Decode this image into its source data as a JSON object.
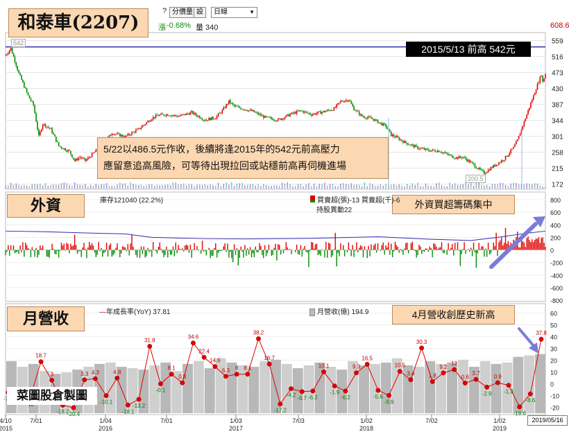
{
  "title": "和泰車(2207)",
  "toolbar": {
    "help": "?",
    "adjust_label": "分價量",
    "settings_label": "設",
    "period_select": "日線",
    "change_prefix": "漲",
    "change_value": "-0.68%",
    "volume_label": "量 340"
  },
  "panels": {
    "foreign_label": "外資",
    "revenue_label": "月營收",
    "foreign_info": "庫存121040 (22.2%)",
    "foreign_legend_1": "買賣超(張)-13 買賣超(千)-6",
    "foreign_legend_2": "持股異動22",
    "revenue_legend_1": "年成長率(YoY) 37.81",
    "revenue_legend_2": "月營收(億) 194.9"
  },
  "annotations": {
    "high_note": "2015/5/13 前高 542元",
    "price_note_1": "5/22以486.5元作收，後續將逢2015年的542元前高壓力",
    "price_note_2": "應留意追高風險，可等待出現拉回或站穩前高再伺機進場",
    "foreign_note": "外資買超籌碼集中",
    "revenue_note": "4月營收創歷史新高",
    "watermark": "菜圖股倉製圖",
    "date_badge": "2019/05/16",
    "high_tag": "542",
    "low_tag": "200.5",
    "right_top": "608.6"
  },
  "colors": {
    "up": "#e00000",
    "down": "#008a00",
    "line": "#2b2bb0",
    "bar": "#b8b8b8",
    "hl": "#7b7bd8"
  },
  "chart_data": [
    {
      "type": "line",
      "title": "和泰車(2207)",
      "y_ticks": [
        "559",
        "516",
        "473",
        "430",
        "387",
        "344",
        "301",
        "258",
        "215",
        "172"
      ],
      "ylim": [
        160,
        575
      ],
      "reference_line": 542,
      "x_ticks": [
        "4/10\n2015",
        "7/01",
        "1/04\n2016",
        "7/01",
        "1/03\n2017",
        "7/03",
        "1/02\n2018",
        "7/02",
        "1/02\n2019"
      ],
      "anchors": [
        [
          0,
          520
        ],
        [
          4,
          538
        ],
        [
          10,
          470
        ],
        [
          17,
          410
        ],
        [
          21,
          385
        ],
        [
          25,
          300
        ],
        [
          28,
          335
        ],
        [
          34,
          320
        ],
        [
          40,
          275
        ],
        [
          48,
          260
        ],
        [
          52,
          235
        ],
        [
          56,
          245
        ],
        [
          60,
          235
        ],
        [
          66,
          255
        ],
        [
          72,
          275
        ],
        [
          80,
          310
        ],
        [
          90,
          300
        ],
        [
          100,
          320
        ],
        [
          105,
          335
        ],
        [
          110,
          350
        ],
        [
          115,
          358
        ],
        [
          122,
          360
        ],
        [
          130,
          355
        ],
        [
          140,
          365
        ],
        [
          150,
          345
        ],
        [
          158,
          352
        ],
        [
          163,
          370
        ],
        [
          168,
          395
        ],
        [
          172,
          382
        ],
        [
          178,
          376
        ],
        [
          186,
          368
        ],
        [
          195,
          352
        ],
        [
          205,
          345
        ],
        [
          214,
          360
        ],
        [
          222,
          370
        ],
        [
          230,
          360
        ],
        [
          240,
          368
        ],
        [
          247,
          375
        ],
        [
          252,
          395
        ],
        [
          258,
          400
        ],
        [
          262,
          375
        ],
        [
          268,
          355
        ],
        [
          276,
          348
        ],
        [
          286,
          328
        ],
        [
          290,
          305
        ],
        [
          294,
          298
        ],
        [
          300,
          285
        ],
        [
          310,
          270
        ],
        [
          318,
          263
        ],
        [
          326,
          262
        ],
        [
          335,
          248
        ],
        [
          339,
          243
        ],
        [
          344,
          245
        ],
        [
          350,
          230
        ],
        [
          356,
          212
        ],
        [
          360,
          202
        ],
        [
          366,
          218
        ],
        [
          375,
          240
        ],
        [
          382,
          270
        ],
        [
          385,
          290
        ],
        [
          389,
          330
        ],
        [
          393,
          370
        ],
        [
          397,
          410
        ],
        [
          400,
          440
        ],
        [
          403,
          468
        ],
        [
          404,
          447
        ],
        [
          406,
          470
        ]
      ]
    },
    {
      "type": "bar",
      "title": "外資",
      "y_ticks": [
        "800",
        "600",
        "400",
        "200",
        "0",
        "-200",
        "-400",
        "-600",
        "-800"
      ],
      "ylim": [
        -800,
        800
      ],
      "holding_line": [
        [
          0,
          300
        ],
        [
          30,
          290
        ],
        [
          60,
          270
        ],
        [
          90,
          255
        ],
        [
          110,
          200
        ],
        [
          150,
          180
        ],
        [
          180,
          175
        ],
        [
          230,
          185
        ],
        [
          260,
          200
        ],
        [
          280,
          210
        ],
        [
          320,
          170
        ],
        [
          350,
          150
        ],
        [
          370,
          200
        ],
        [
          390,
          260
        ],
        [
          406,
          300
        ]
      ]
    },
    {
      "type": "bar",
      "title": "月營收",
      "y_ticks": [
        "60",
        "50",
        "40",
        "30",
        "20",
        "10",
        "0",
        "-10",
        "-20"
      ],
      "ylim": [
        -25,
        65
      ],
      "revenue_bars": [
        16,
        12,
        14,
        9,
        7,
        8,
        10,
        12,
        14,
        15,
        12,
        11,
        10,
        13,
        15,
        9,
        14,
        16,
        11,
        18,
        15,
        13,
        12,
        16,
        17,
        14,
        11,
        13,
        15,
        12,
        10,
        16,
        13,
        14,
        15,
        18,
        13,
        12,
        16,
        14,
        15,
        17,
        12,
        16,
        14,
        15,
        19,
        20,
        21
      ],
      "yoy": [
        -7.4,
        -10.7,
        -12,
        18.7,
        3,
        -18.2,
        -20.4,
        3.3,
        4.3,
        -10.1,
        4.8,
        -18.1,
        -13.2,
        31.8,
        -0.1,
        8.1,
        0.8,
        34.6,
        22.4,
        14.6,
        6.3,
        8.1,
        8.1,
        38.2,
        16.7,
        -17.2,
        -4.2,
        -6.7,
        -6.2,
        10.1,
        -1.9,
        -6.2,
        9.3,
        16.5,
        -5.6,
        -9.9,
        10.5,
        3.4,
        30.3,
        1.8,
        9.2,
        12,
        0.6,
        3.7,
        -2.9,
        0.9,
        -1.3,
        -19.6,
        -8.6,
        37.8
      ],
      "yoy_labels": [
        "-7.4",
        "-10.7",
        "-12",
        "18.7",
        "3",
        "-18.2",
        "-20.4",
        "3.3",
        "4.3",
        "-10.1",
        "4.8",
        "-18.1",
        "-13.2",
        "31.8",
        "-0.1",
        "8.1",
        "0.8",
        "34.6",
        "22.4",
        "14.6",
        "6.3",
        "8",
        "8.1",
        "38.2",
        "16.7",
        "-17.2",
        "-4.2",
        "-6.7",
        "-6.2",
        "10.1",
        "-1.9",
        "-6.2",
        "9.3",
        "16.5",
        "-5.6",
        "-9.9",
        "10.5",
        "3.4",
        "30.3",
        "1.8",
        "9.2",
        "12",
        "0.6",
        "3.7",
        "-2.9",
        "0.9",
        "-1.3",
        "-19.6",
        "-8.6",
        "37.8"
      ]
    }
  ]
}
